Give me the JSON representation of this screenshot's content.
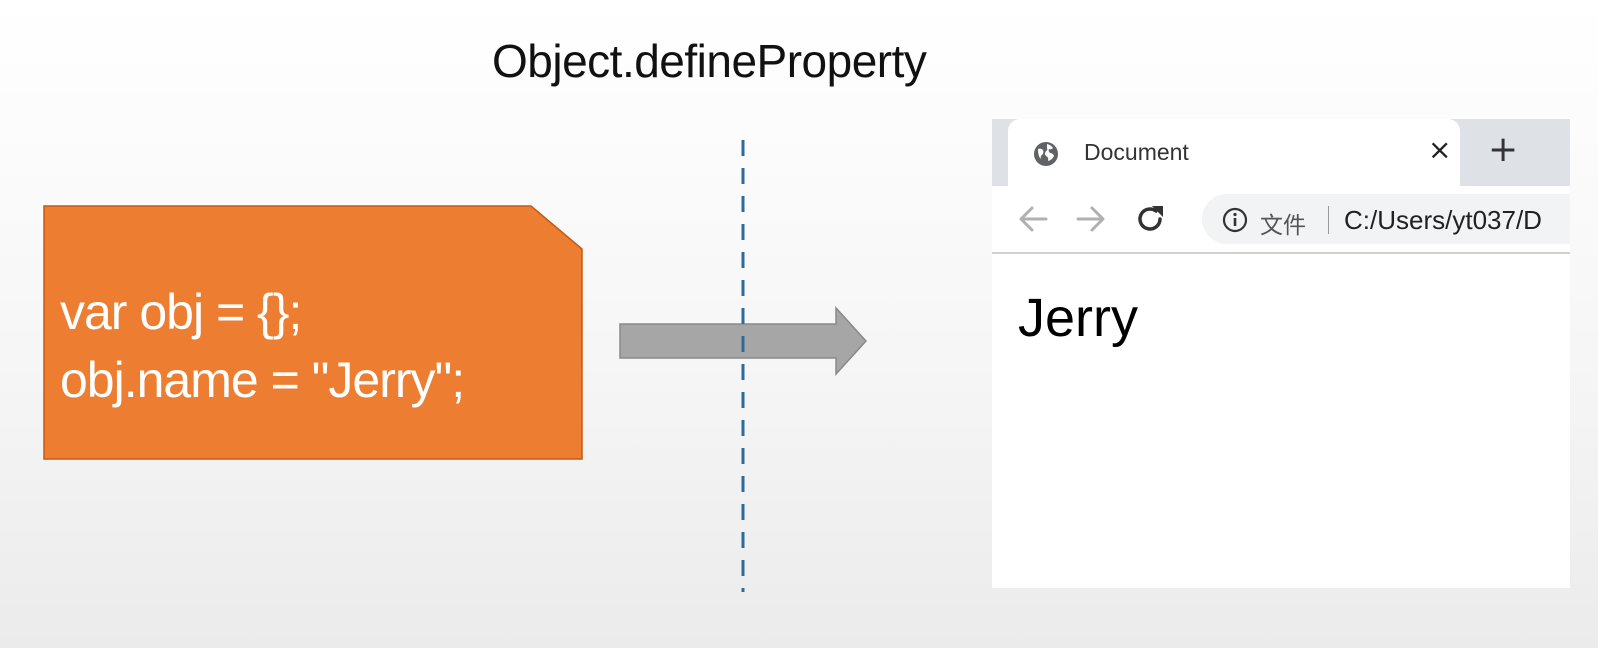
{
  "diagram": {
    "title": "Object.defineProperty",
    "code_lines": [
      "var obj = {};",
      "obj.name = \"Jerry\";"
    ],
    "colors": {
      "code_box": "#ed7d31",
      "arrow": "#a6a6a6",
      "divider": "#2e6a9a"
    }
  },
  "browser": {
    "tab": {
      "title": "Document",
      "close_icon": "close-icon",
      "globe_icon": "globe-icon"
    },
    "new_tab_icon": "plus-icon",
    "toolbar": {
      "back_icon": "back-arrow-icon",
      "forward_icon": "forward-arrow-icon",
      "reload_icon": "reload-icon"
    },
    "address": {
      "info_icon": "info-icon",
      "scheme_label": "文件",
      "url": "C:/Users/yt037/D"
    },
    "page": {
      "content": "Jerry"
    }
  }
}
